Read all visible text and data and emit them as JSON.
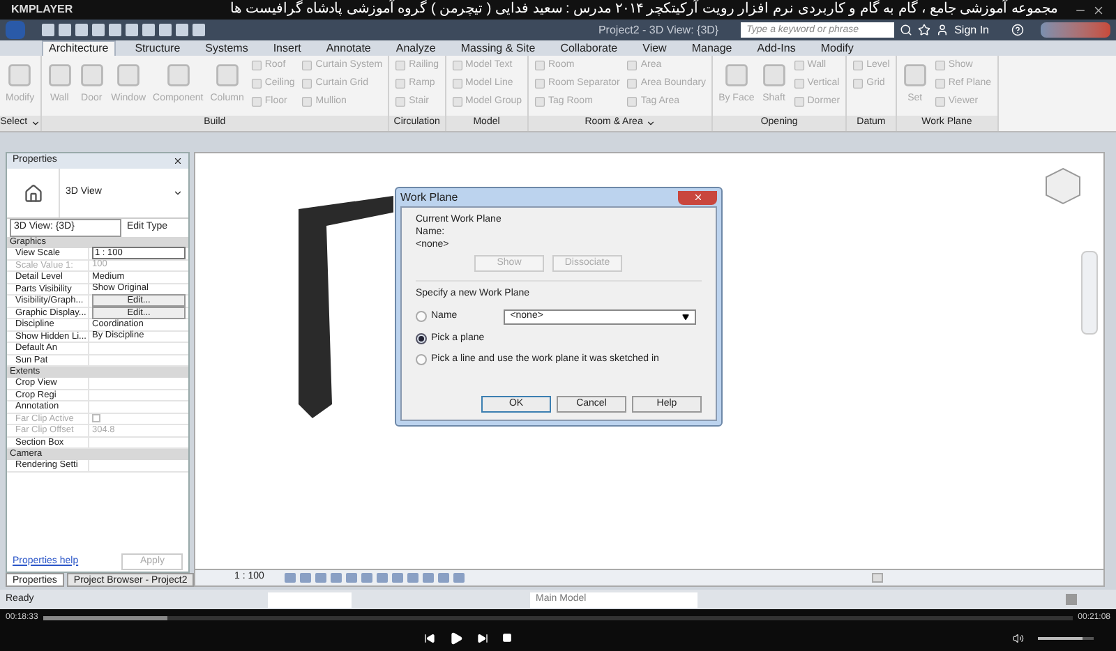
{
  "player": {
    "brand": "KMPLAYER",
    "title": "مجموعه آموزشی جامع ، گام به گام و کاربردی نرم افزار رویت آرکیتکچر ۲۰۱۴   مدرس : سعید فدایی ( تیچرمن ) گروه آموزشی پادشاه گرافیست ها",
    "elapsed": "00:18:33",
    "total": "00:21:08",
    "progress": {
      "level": 0.12
    },
    "volume": {
      "level": 0.8
    }
  },
  "app": {
    "title": "Project2 - 3D View: {3D}",
    "search": {
      "placeholder": "Type a keyword or phrase"
    },
    "sign_in": "Sign In"
  },
  "tabs": [
    {
      "label": "Architecture",
      "selected": true
    },
    {
      "label": "Structure",
      "selected": false
    },
    {
      "label": "Systems",
      "selected": false
    },
    {
      "label": "Insert",
      "selected": false
    },
    {
      "label": "Annotate",
      "selected": false
    },
    {
      "label": "Analyze",
      "selected": false
    },
    {
      "label": "Massing & Site",
      "selected": false
    },
    {
      "label": "Collaborate",
      "selected": false
    },
    {
      "label": "View",
      "selected": false
    },
    {
      "label": "Manage",
      "selected": false
    },
    {
      "label": "Add-Ins",
      "selected": false
    },
    {
      "label": "Modify",
      "selected": false
    }
  ],
  "ribbon": {
    "disabled": true,
    "groups": [
      {
        "label": "Select",
        "dropdown": true,
        "tools": [
          {
            "kind": "large",
            "label": "Modify"
          }
        ]
      },
      {
        "label": "Build",
        "dropdown": false,
        "tools": [
          {
            "kind": "large",
            "label": "Wall"
          },
          {
            "kind": "large",
            "label": "Door"
          },
          {
            "kind": "large",
            "label": "Window"
          },
          {
            "kind": "large",
            "label": "Component"
          },
          {
            "kind": "large",
            "label": "Column"
          },
          {
            "kind": "stack",
            "items": [
              "Roof",
              "Ceiling",
              "Floor"
            ]
          },
          {
            "kind": "stack",
            "items": [
              "Curtain System",
              "Curtain Grid",
              "Mullion"
            ]
          }
        ]
      },
      {
        "label": "Circulation",
        "dropdown": false,
        "tools": [
          {
            "kind": "stack",
            "items": [
              "Railing",
              "Ramp",
              "Stair"
            ]
          }
        ]
      },
      {
        "label": "Model",
        "dropdown": false,
        "tools": [
          {
            "kind": "stack",
            "items": [
              "Model Text",
              "Model Line",
              "Model Group"
            ]
          }
        ]
      },
      {
        "label": "Room & Area",
        "dropdown": true,
        "tools": [
          {
            "kind": "stack",
            "items": [
              "Room",
              "Room Separator",
              "Tag Room"
            ]
          },
          {
            "kind": "stack",
            "items": [
              "Area",
              "Area Boundary",
              "Tag Area"
            ]
          }
        ]
      },
      {
        "label": "Opening",
        "dropdown": false,
        "tools": [
          {
            "kind": "large",
            "label": "By Face"
          },
          {
            "kind": "large",
            "label": "Shaft"
          },
          {
            "kind": "stack",
            "items": [
              "Wall",
              "Vertical",
              "Dormer"
            ]
          }
        ]
      },
      {
        "label": "Datum",
        "dropdown": false,
        "tools": [
          {
            "kind": "stack",
            "items": [
              "Level",
              "Grid"
            ]
          }
        ]
      },
      {
        "label": "Work Plane",
        "dropdown": false,
        "tools": [
          {
            "kind": "large",
            "label": "Set"
          },
          {
            "kind": "stack",
            "items": [
              "Show",
              "Ref Plane",
              "Viewer"
            ]
          }
        ]
      }
    ]
  },
  "properties": {
    "title": "Properties",
    "type": "3D View",
    "selector": "3D View: {3D}",
    "edit_type": "Edit Type",
    "sections": [
      {
        "title": "Graphics",
        "rows": [
          {
            "label": "View Scale",
            "value": "1 : 100",
            "kind": "field",
            "disabled": false
          },
          {
            "label": "Scale Value    1:",
            "value": "100",
            "kind": "text",
            "disabled": true
          },
          {
            "label": "Detail Level",
            "value": "Medium",
            "kind": "text",
            "disabled": false
          },
          {
            "label": "Parts Visibility",
            "value": "Show Original",
            "kind": "text",
            "disabled": false
          },
          {
            "label": "Visibility/Graph...",
            "value": "Edit...",
            "kind": "button",
            "disabled": false
          },
          {
            "label": "Graphic Display...",
            "value": "Edit...",
            "kind": "button",
            "disabled": false
          },
          {
            "label": "Discipline",
            "value": "Coordination",
            "kind": "text",
            "disabled": false
          },
          {
            "label": "Show Hidden Li...",
            "value": "By Discipline",
            "kind": "text",
            "disabled": false
          },
          {
            "label": "Default An",
            "kind": "text",
            "disabled": false
          },
          {
            "label": "Sun Pat",
            "kind": "text",
            "disabled": false
          }
        ]
      },
      {
        "title": "Extents",
        "rows": [
          {
            "label": "Crop View",
            "kind": "text",
            "disabled": false
          },
          {
            "label": "Crop Regi",
            "kind": "text",
            "disabled": false
          },
          {
            "label": "Annotation",
            "kind": "text",
            "disabled": false
          },
          {
            "label": "Far Clip Active",
            "kind": "checkbox",
            "checked": false,
            "disabled": true
          },
          {
            "label": "Far Clip Offset",
            "value": "304.8",
            "kind": "text",
            "disabled": true
          },
          {
            "label": "Section Box",
            "kind": "text",
            "disabled": false
          }
        ]
      },
      {
        "title": "Camera",
        "rows": [
          {
            "label": "Rendering Setti",
            "kind": "text",
            "disabled": false
          }
        ]
      }
    ],
    "help": "Properties help",
    "apply": "Apply"
  },
  "bottom_tabs": [
    {
      "label": "Properties",
      "selected": true
    },
    {
      "label": "Project Browser - Project2",
      "selected": false
    }
  ],
  "view_bar": {
    "scale": "1 : 100"
  },
  "status_bar": {
    "text": "Ready",
    "model": "Main Model"
  },
  "dialog": {
    "title": "Work Plane",
    "current_heading": "Current Work Plane",
    "name_label": "Name:",
    "name_value": "<none>",
    "show": "Show",
    "dissociate": "Dissociate",
    "specify_heading": "Specify a new Work Plane",
    "options": [
      {
        "label": "Name",
        "selected": false,
        "kind": "dropdown",
        "value": "<none>"
      },
      {
        "label": "Pick a plane",
        "selected": true,
        "kind": "plain"
      },
      {
        "label": "Pick a line and use the work plane it was sketched in",
        "selected": false,
        "kind": "plain"
      }
    ],
    "buttons": [
      "OK",
      "Cancel",
      "Help"
    ]
  }
}
